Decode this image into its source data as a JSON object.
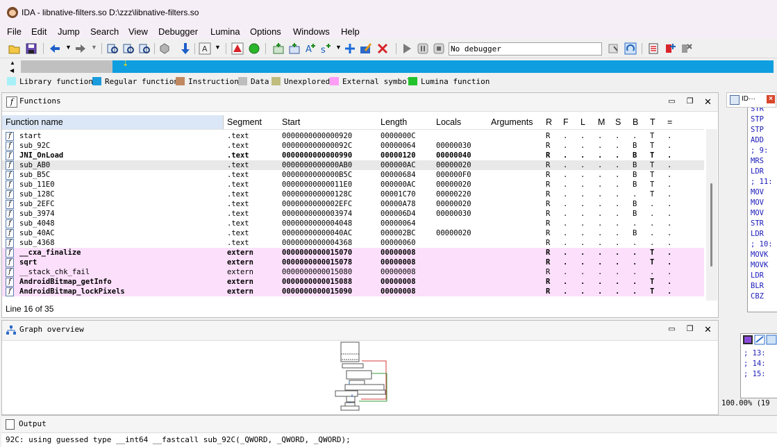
{
  "window": {
    "title": "IDA - libnative-filters.so D:\\zzz\\libnative-filters.so"
  },
  "menu": [
    "File",
    "Edit",
    "Jump",
    "Search",
    "View",
    "Debugger",
    "Lumina",
    "Options",
    "Windows",
    "Help"
  ],
  "toolbar": {
    "debugger_select": "No debugger"
  },
  "legend": [
    {
      "label": "Library function",
      "color": "#a8f0f8"
    },
    {
      "label": "Regular function",
      "color": "#1a9bdc"
    },
    {
      "label": "Instruction",
      "color": "#c08860"
    },
    {
      "label": "Data",
      "color": "#bdbdbd"
    },
    {
      "label": "Unexplored",
      "color": "#bfbc7e"
    },
    {
      "label": "External symbol",
      "color": "#ff9cf6"
    },
    {
      "label": "Lumina function",
      "color": "#22c22c"
    }
  ],
  "functions_panel": {
    "title": "Functions",
    "columns": [
      "Function name",
      "Segment",
      "Start",
      "Length",
      "Locals",
      "Arguments",
      "R",
      "F",
      "L",
      "M",
      "S",
      "B",
      "T",
      "="
    ],
    "rows": [
      {
        "name": "start",
        "segment": ".text",
        "start": "0000000000000920",
        "length": "0000000C",
        "locals": "",
        "args": "",
        "flags": [
          "R",
          ".",
          ".",
          ".",
          ".",
          ".",
          "T",
          "."
        ],
        "ext": false,
        "bold": false,
        "sel": false
      },
      {
        "name": "sub_92C",
        "segment": ".text",
        "start": "000000000000092C",
        "length": "00000064",
        "locals": "00000030",
        "args": "",
        "flags": [
          "R",
          ".",
          ".",
          ".",
          ".",
          "B",
          "T",
          "."
        ],
        "ext": false,
        "bold": false,
        "sel": false
      },
      {
        "name": "JNI_OnLoad",
        "segment": ".text",
        "start": "0000000000000990",
        "length": "00000120",
        "locals": "00000040",
        "args": "",
        "flags": [
          "R",
          ".",
          ".",
          ".",
          ".",
          "B",
          "T",
          "."
        ],
        "ext": false,
        "bold": true,
        "sel": false
      },
      {
        "name": "sub_AB0",
        "segment": ".text",
        "start": "0000000000000AB0",
        "length": "000000AC",
        "locals": "00000020",
        "args": "",
        "flags": [
          "R",
          ".",
          ".",
          ".",
          ".",
          "B",
          "T",
          "."
        ],
        "ext": false,
        "bold": false,
        "sel": true
      },
      {
        "name": "sub_B5C",
        "segment": ".text",
        "start": "0000000000000B5C",
        "length": "00000684",
        "locals": "000000F0",
        "args": "",
        "flags": [
          "R",
          ".",
          ".",
          ".",
          ".",
          "B",
          "T",
          "."
        ],
        "ext": false,
        "bold": false,
        "sel": false
      },
      {
        "name": "sub_11E0",
        "segment": ".text",
        "start": "00000000000011E0",
        "length": "000000AC",
        "locals": "00000020",
        "args": "",
        "flags": [
          "R",
          ".",
          ".",
          ".",
          ".",
          "B",
          "T",
          "."
        ],
        "ext": false,
        "bold": false,
        "sel": false
      },
      {
        "name": "sub_128C",
        "segment": ".text",
        "start": "000000000000128C",
        "length": "00001C70",
        "locals": "00000220",
        "args": "",
        "flags": [
          "R",
          ".",
          ".",
          ".",
          ".",
          ".",
          "T",
          "."
        ],
        "ext": false,
        "bold": false,
        "sel": false
      },
      {
        "name": "sub_2EFC",
        "segment": ".text",
        "start": "0000000000002EFC",
        "length": "00000A78",
        "locals": "00000020",
        "args": "",
        "flags": [
          "R",
          ".",
          ".",
          ".",
          ".",
          "B",
          ".",
          "."
        ],
        "ext": false,
        "bold": false,
        "sel": false
      },
      {
        "name": "sub_3974",
        "segment": ".text",
        "start": "0000000000003974",
        "length": "000006D4",
        "locals": "00000030",
        "args": "",
        "flags": [
          "R",
          ".",
          ".",
          ".",
          ".",
          "B",
          ".",
          "."
        ],
        "ext": false,
        "bold": false,
        "sel": false
      },
      {
        "name": "sub_4048",
        "segment": ".text",
        "start": "0000000000004048",
        "length": "00000064",
        "locals": "",
        "args": "",
        "flags": [
          "R",
          ".",
          ".",
          ".",
          ".",
          ".",
          ".",
          "."
        ],
        "ext": false,
        "bold": false,
        "sel": false
      },
      {
        "name": "sub_40AC",
        "segment": ".text",
        "start": "00000000000040AC",
        "length": "000002BC",
        "locals": "00000020",
        "args": "",
        "flags": [
          "R",
          ".",
          ".",
          ".",
          ".",
          "B",
          ".",
          "."
        ],
        "ext": false,
        "bold": false,
        "sel": false
      },
      {
        "name": "sub_4368",
        "segment": ".text",
        "start": "0000000000004368",
        "length": "00000060",
        "locals": "",
        "args": "",
        "flags": [
          "R",
          ".",
          ".",
          ".",
          ".",
          ".",
          ".",
          "."
        ],
        "ext": false,
        "bold": false,
        "sel": false
      },
      {
        "name": "__cxa_finalize",
        "segment": "extern",
        "start": "0000000000015070",
        "length": "00000008",
        "locals": "",
        "args": "",
        "flags": [
          "R",
          ".",
          ".",
          ".",
          ".",
          ".",
          "T",
          "."
        ],
        "ext": true,
        "bold": true,
        "sel": false
      },
      {
        "name": "sqrt",
        "segment": "extern",
        "start": "0000000000015078",
        "length": "00000008",
        "locals": "",
        "args": "",
        "flags": [
          "R",
          ".",
          ".",
          ".",
          ".",
          ".",
          "T",
          "."
        ],
        "ext": true,
        "bold": true,
        "sel": false
      },
      {
        "name": "__stack_chk_fail",
        "segment": "extern",
        "start": "0000000000015080",
        "length": "00000008",
        "locals": "",
        "args": "",
        "flags": [
          "R",
          ".",
          ".",
          ".",
          ".",
          ".",
          ".",
          "."
        ],
        "ext": true,
        "bold": false,
        "sel": false
      },
      {
        "name": "AndroidBitmap_getInfo",
        "segment": "extern",
        "start": "0000000000015088",
        "length": "00000008",
        "locals": "",
        "args": "",
        "flags": [
          "R",
          ".",
          ".",
          ".",
          ".",
          ".",
          "T",
          "."
        ],
        "ext": true,
        "bold": true,
        "sel": false
      },
      {
        "name": "AndroidBitmap_lockPixels",
        "segment": "extern",
        "start": "0000000000015090",
        "length": "00000008",
        "locals": "",
        "args": "",
        "flags": [
          "R",
          ".",
          ".",
          ".",
          ".",
          ".",
          "T",
          "."
        ],
        "ext": true,
        "bold": true,
        "sel": false
      }
    ],
    "status": "Line 16 of 35"
  },
  "graph_overview": {
    "title": "Graph overview"
  },
  "output": {
    "title": "Output",
    "line": "92C: using guessed type __int64 __fastcall sub_92C(_QWORD, _QWORD, _QWORD);"
  },
  "side_panel": {
    "tab_label": "ID···",
    "code": [
      "STR",
      "STP",
      "STP",
      "ADD",
      "; 9:",
      "MRS",
      "LDR",
      "; 11:",
      "MOV",
      "MOV",
      "MOV",
      "STR",
      "LDR",
      "; 10:",
      "MOVK",
      "MOVK",
      "LDR",
      "BLR",
      "CBZ"
    ],
    "mini_code": [
      "; 13:",
      "; 14:",
      "; 15:"
    ],
    "zoom": "100.00% (19"
  }
}
